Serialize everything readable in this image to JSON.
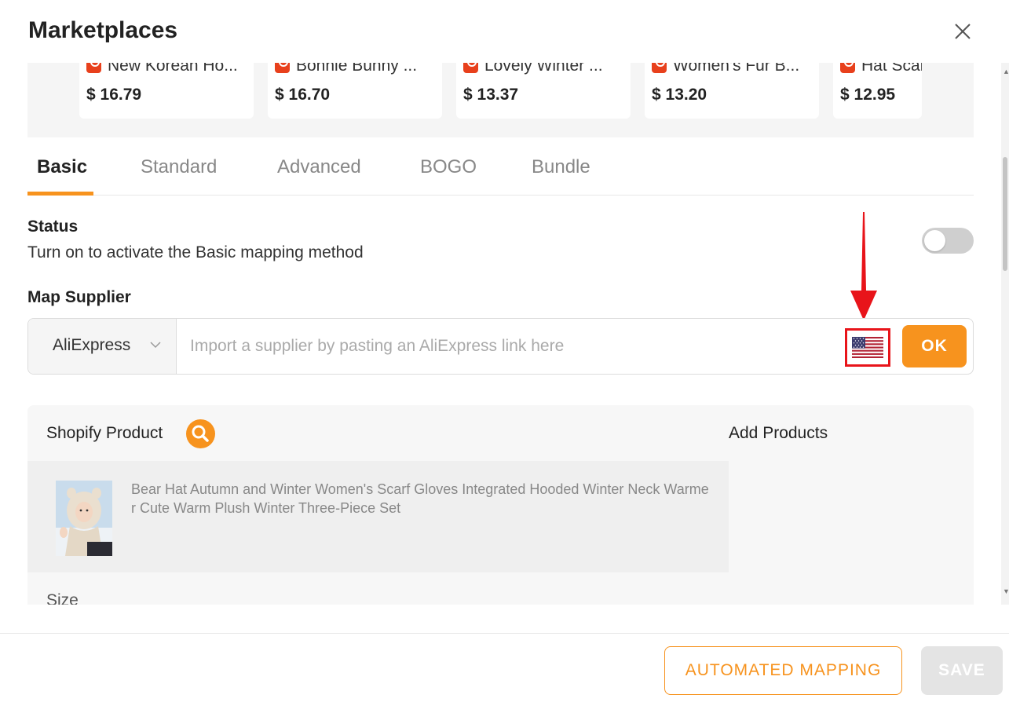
{
  "modal": {
    "title": "Marketplaces"
  },
  "product_cards": [
    {
      "title": "New Korean Ho...",
      "price": "$ 16.79"
    },
    {
      "title": "Bonnie Bunny ...",
      "price": "$ 16.70"
    },
    {
      "title": "Lovely Winter ...",
      "price": "$ 13.37"
    },
    {
      "title": "Women's Fur B...",
      "price": "$ 13.20"
    },
    {
      "title": "Hat Scar",
      "price": "$ 12.95"
    }
  ],
  "tabs": [
    {
      "label": "Basic",
      "active": true
    },
    {
      "label": "Standard",
      "active": false
    },
    {
      "label": "Advanced",
      "active": false
    },
    {
      "label": "BOGO",
      "active": false
    },
    {
      "label": "Bundle",
      "active": false
    }
  ],
  "status": {
    "title": "Status",
    "description": "Turn on to activate the Basic mapping method",
    "enabled": false
  },
  "map_supplier": {
    "title": "Map Supplier",
    "selected": "AliExpress",
    "input_value": "",
    "placeholder": "Import a supplier by pasting an AliExpress link here",
    "ok_label": "OK",
    "country_flag": "us-flag-icon"
  },
  "panel": {
    "shopify_label": "Shopify Product",
    "add_products_label": "Add Products",
    "product_title": "Bear Hat Autumn and Winter Women's Scarf Gloves Integrated Hooded Winter Neck Warmer Cute Warm Plush Winter Three-Piece Set",
    "size_label": "Size"
  },
  "footer": {
    "automated_label": "AUTOMATED MAPPING",
    "save_label": "SAVE"
  },
  "colors": {
    "accent": "#f7931e",
    "store_red": "#e8401c",
    "highlight_red": "#e8141a"
  }
}
